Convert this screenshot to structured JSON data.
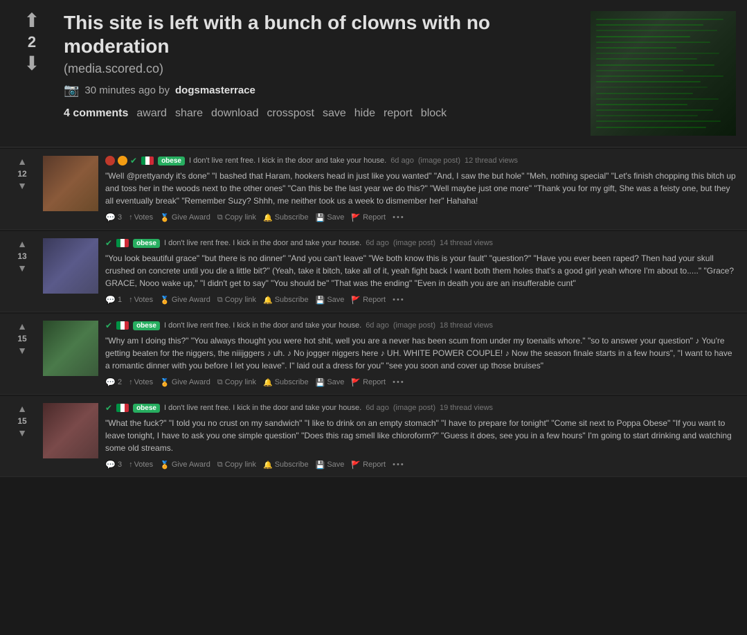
{
  "post": {
    "vote_count": "2",
    "title": "This site is left with a bunch of clowns with no moderation",
    "domain": "(media.scored.co)",
    "time_ago": "30 minutes ago by",
    "author": "dogsmasterrace",
    "comments_label": "4 comments",
    "actions": [
      "award",
      "share",
      "download",
      "crosspost",
      "save",
      "hide",
      "report",
      "block"
    ]
  },
  "comments": [
    {
      "id": 1,
      "vote_count": "12",
      "username": "obese",
      "flair": "I don't live rent free. I kick in the door and take your house.",
      "time": "6d ago",
      "type": "(image post)",
      "thread_views": "12 thread views",
      "text": "\"Well @prettyandy it's done\" \"I bashed that Haram, hookers head in just like you wanted\" \"And, I saw the but hole\" \"Meh, nothing special\" \"Let's finish chopping this bitch up and toss her in the woods next to the other ones\" \"Can this be the last year we do this?\" \"Well maybe just one more\" \"Thank you for my gift, She was a feisty one, but they all eventually break\" \"Remember Suzy? Shhh, me neither took us a week to dismember her\" Hahaha!",
      "reply_count": "3",
      "footer_items": [
        "Votes",
        "Give Award",
        "Copy link",
        "Subscribe",
        "Save",
        "Report"
      ]
    },
    {
      "id": 2,
      "vote_count": "13",
      "username": "obese",
      "flair": "I don't live rent free. I kick in the door and take your house.",
      "time": "6d ago",
      "type": "(image post)",
      "thread_views": "14 thread views",
      "text": "\"You look beautiful grace\" \"but there is no dinner\" \"And you can't leave\" \"We both know this is your fault\" \"question?\" \"Have you ever been raped? Then had your skull crushed on concrete until you die a little bit?\" (Yeah, take it bitch, take all of it, yeah fight back I want both them holes that's a good girl yeah whore I'm about to.....\" \"Grace? GRACE, Nooo wake up,\" \"I didn't get to say\" \"You should be\" \"That was the ending\" \"Even in death you are an insufferable cunt\"",
      "reply_count": "1",
      "footer_items": [
        "Votes",
        "Give Award",
        "Copy link",
        "Subscribe",
        "Save",
        "Report"
      ]
    },
    {
      "id": 3,
      "vote_count": "15",
      "username": "obese",
      "flair": "I don't live rent free. I kick in the door and take your house.",
      "time": "6d ago",
      "type": "(image post)",
      "thread_views": "18 thread views",
      "text": "\"Why am I doing this?\" \"You always thought you were hot shit, well you are a never has been scum from under my toenails whore.\" \"so to answer your question\" ♪ You're getting beaten for the niggers, the niiijggers ♪ uh. ♪ No jogger niggers here ♪ UH. WHITE POWER COUPLE! ♪ Now the season finale starts in a few hours\", \"I want to have a romantic dinner with you before I let you leave\". I\" laid out a dress for you\" \"see you soon and cover up those bruises\"",
      "reply_count": "2",
      "footer_items": [
        "Votes",
        "Give Award",
        "Copy link",
        "Subscribe",
        "Save",
        "Report"
      ]
    },
    {
      "id": 4,
      "vote_count": "15",
      "username": "obese",
      "flair": "I don't live rent free. I kick in the door and take your house.",
      "time": "6d ago",
      "type": "(image post)",
      "thread_views": "19 thread views",
      "text": "\"What the fuck?\" \"I told you no crust on my sandwich\" \"I like to drink on an empty stomach\" \"I have to prepare for tonight\" \"Come sit next to Poppa Obese\" \"If you want to leave tonight, I have to ask you one simple question\" \"Does this rag smell like chloroform?\" \"Guess it does, see you in a few hours\" I'm going to start drinking and watching some old streams.",
      "reply_count": "3",
      "footer_items": [
        "Votes",
        "Give Award",
        "Copy link",
        "Subscribe",
        "Save",
        "Report"
      ]
    }
  ],
  "icons": {
    "up_arrow": "⬆",
    "down_arrow": "⬇",
    "camera": "📷",
    "comment_up": "▲",
    "comment_down": "▼",
    "copy_icon": "⧉",
    "award_icon": "🏆",
    "subscribe_icon": "🔔",
    "save_icon": "💾",
    "report_icon": "🚩",
    "votes_icon": "↑"
  }
}
